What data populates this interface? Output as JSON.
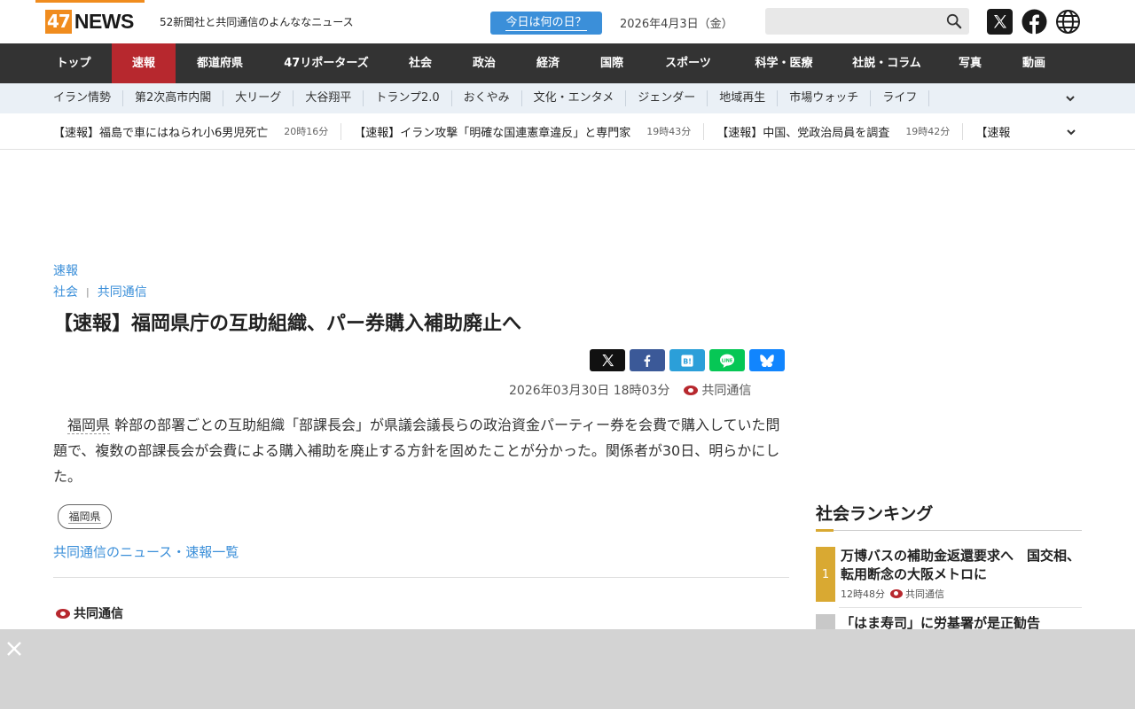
{
  "header": {
    "logo_number": "47",
    "logo_text": "NEWS",
    "tagline": "52新聞社と共同通信のよんななニュース",
    "today_button": "今日は何の日？",
    "date": "2026年4月3日（金）",
    "search_placeholder": ""
  },
  "main_nav": [
    {
      "label": "トップ",
      "width": 86
    },
    {
      "label": "速報",
      "width": 72,
      "active": true
    },
    {
      "label": "都道府県",
      "width": 100
    },
    {
      "label": "47リポーターズ",
      "width": 140
    },
    {
      "label": "社会",
      "width": 72
    },
    {
      "label": "政治",
      "width": 72
    },
    {
      "label": "経済",
      "width": 72
    },
    {
      "label": "国際",
      "width": 72
    },
    {
      "label": "スポーツ",
      "width": 100
    },
    {
      "label": "科学・医療",
      "width": 116
    },
    {
      "label": "社説・コラム",
      "width": 116
    },
    {
      "label": "写真",
      "width": 72
    },
    {
      "label": "動画",
      "width": 72
    }
  ],
  "sub_nav": [
    "イラン情勢",
    "第2次高市内閣",
    "大リーグ",
    "大谷翔平",
    "トランプ2.0",
    "おくやみ",
    "文化・エンタメ",
    "ジェンダー",
    "地域再生",
    "市場ウォッチ",
    "ライフ"
  ],
  "ticker": [
    {
      "headline": "【速報】福島で車にはねられ小6男児死亡",
      "time": "20時16分"
    },
    {
      "headline": "【速報】イラン攻撃「明確な国連憲章違反」と専門家",
      "time": "19時43分"
    },
    {
      "headline": "【速報】中国、党政治局員を調査",
      "time": "19時42分"
    },
    {
      "headline": "【速報",
      "time": ""
    }
  ],
  "article": {
    "category": "速報",
    "section": "社会",
    "source_link": "共同通信",
    "headline": "【速報】福岡県庁の互助組織、パー券購入補助廃止へ",
    "datetime": "2026年03月30日 18時03分",
    "source": "共同通信",
    "body_keyword": "福岡県",
    "body_rest": " 幹部の部署ごとの互助組織「部課長会」が県議会議長らの政治資金パーティー券を会費で購入していた問題で、複数の部課長会が会費による購入補助を廃止する方針を固めたことが分かった。関係者が30日、明らかにした。",
    "tag": "福岡県",
    "more_link": "共同通信のニュース・速報一覧",
    "footer_source": "共同通信"
  },
  "share_buttons": [
    {
      "name": "x",
      "color": "#111111"
    },
    {
      "name": "facebook",
      "color": "#3b5998"
    },
    {
      "name": "hatena",
      "color": "#2b9fd9"
    },
    {
      "name": "line",
      "color": "#06c755"
    },
    {
      "name": "bluesky",
      "color": "#1185fe"
    }
  ],
  "ranking": {
    "title": "社会ランキング",
    "items": [
      {
        "rank": "1",
        "headline": "万博バスの補助金返還要求へ　国交相、転用断念の大阪メトロに",
        "time": "12時48分",
        "source": "共同通信",
        "color": "#d9a932"
      },
      {
        "rank": "",
        "headline": "「はま寿司」に労基署が是正勧告",
        "time": "",
        "source": "",
        "color": "#c8c8c8"
      }
    ]
  },
  "colors": {
    "accent_orange": "#f08c1e",
    "nav_active": "#b7282e",
    "link_blue": "#3b8fd9",
    "nav_dark": "#333333"
  }
}
